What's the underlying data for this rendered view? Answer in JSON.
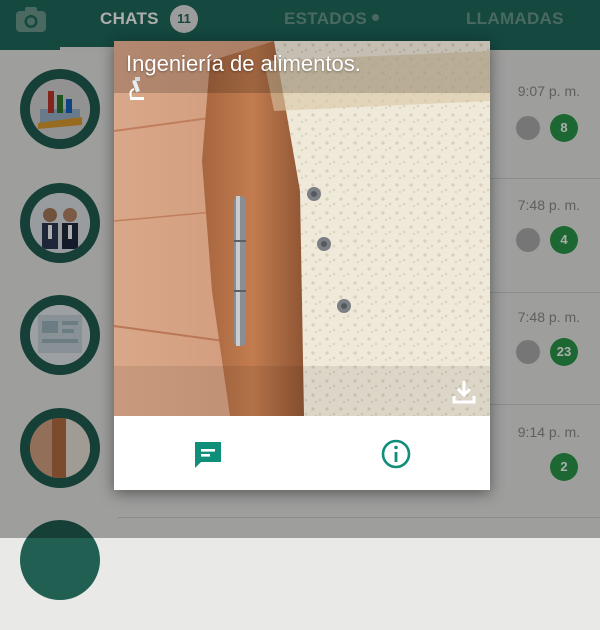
{
  "header": {
    "tabs": [
      {
        "label": "CHATS",
        "active": true,
        "badge": "11"
      },
      {
        "label": "ESTADOS",
        "active": false
      },
      {
        "label": "LLAMADAS",
        "active": false
      }
    ],
    "colors": {
      "bar": "#1f6a5d",
      "accent_green": "#2c9a4b"
    }
  },
  "chats": [
    {
      "time": "9:07 p. m.",
      "unread": "8",
      "pinned": true
    },
    {
      "time": "7:48 p. m.",
      "unread": "4",
      "pinned": true
    },
    {
      "time": "7:48 p. m.",
      "unread": "23",
      "pinned": true
    },
    {
      "time": "9:14 p. m.",
      "unread": "2",
      "pinned": false
    }
  ],
  "popup": {
    "title": "Ingeniería de alimentos.",
    "title_icon": "microscope-icon",
    "actions": [
      {
        "icon": "message-icon"
      },
      {
        "icon": "info-icon"
      }
    ],
    "download_icon": "download-icon"
  }
}
